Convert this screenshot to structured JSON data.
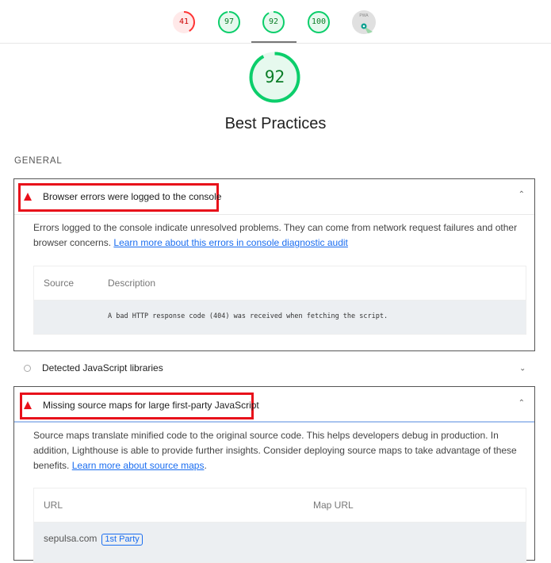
{
  "scores": [
    {
      "label": "41",
      "value": 41,
      "color": "#ff3333",
      "bg": "#ffe9e9",
      "text_color": "#c00"
    },
    {
      "label": "97",
      "value": 97,
      "color": "#0cce6b",
      "bg": "#e6f9ee",
      "text_color": "#0a7d27"
    },
    {
      "label": "92",
      "value": 92,
      "color": "#0cce6b",
      "bg": "#e6f9ee",
      "text_color": "#0a7d27"
    },
    {
      "label": "100",
      "value": 100,
      "color": "#0cce6b",
      "bg": "#e6f9ee",
      "text_color": "#0a7d27"
    }
  ],
  "pwa_label": "PWA",
  "category": {
    "score": "92",
    "score_value": 92,
    "title": "Best Practices"
  },
  "group_title": "GENERAL",
  "audits": [
    {
      "title": "Browser errors were logged to the console",
      "description": "Errors logged to the console indicate unresolved problems. They can come from network request failures and other browser concerns.",
      "link": "Learn more about this errors in console diagnostic audit",
      "columns": [
        "Source",
        "Description"
      ],
      "rows": [
        {
          "source": "",
          "description": "A bad HTTP response code (404) was received when fetching the script."
        }
      ]
    },
    {
      "title": "Detected JavaScript libraries"
    },
    {
      "title": "Missing source maps for large first-party JavaScript",
      "description": "Source maps translate minified code to the original source code. This helps developers debug in production. In addition, Lighthouse is able to provide further insights. Consider deploying source maps to take advantage of these benefits.",
      "link": "Learn more about source maps",
      "columns": [
        "URL",
        "Map URL"
      ],
      "rows": [
        {
          "url": "sepulsa.com",
          "badge": "1st Party"
        }
      ]
    }
  ],
  "colors": {
    "fail": "#e8101a",
    "pass": "#0cce6b",
    "link": "#1a6df0"
  }
}
